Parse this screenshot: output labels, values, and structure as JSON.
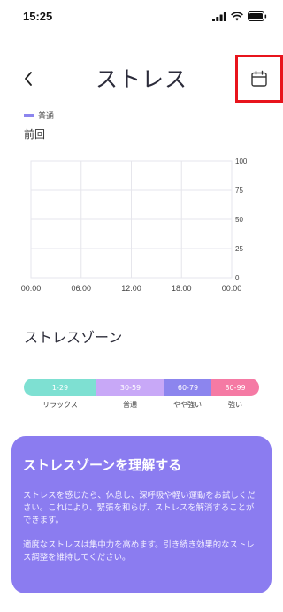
{
  "status_bar": {
    "time": "15:25"
  },
  "header": {
    "title": "ストレス"
  },
  "legend": {
    "label": "普通",
    "color": "#8c85ee"
  },
  "period_label": "前回",
  "chart_data": {
    "type": "line",
    "x_tick_labels": [
      "00:00",
      "06:00",
      "12:00",
      "18:00",
      "00:00"
    ],
    "y_tick_labels": [
      "100",
      "75",
      "50",
      "25",
      "0"
    ],
    "ylim": [
      0,
      100
    ],
    "series": [],
    "grid": true,
    "legend_position": "top-left"
  },
  "stress_zone": {
    "title": "ストレスゾーン",
    "segments": [
      {
        "range": "1-29",
        "label": "リラックス",
        "color": "#7ee0d2"
      },
      {
        "range": "30-59",
        "label": "普通",
        "color": "#c8a8f7"
      },
      {
        "range": "60-79",
        "label": "やや強い",
        "color": "#8c85ee"
      },
      {
        "range": "80-99",
        "label": "強い",
        "color": "#f57aa4"
      }
    ]
  },
  "info_card": {
    "title": "ストレスゾーンを理解する",
    "paragraph1": "ストレスを感じたら、休息し、深呼吸や軽い運動をお試しください。これにより、緊張を和らげ、ストレスを解消することができます。",
    "paragraph2": "適度なストレスは集中力を高めます。引き続き効果的なストレス調整を維持してください。",
    "color": "#8b7cf0"
  }
}
